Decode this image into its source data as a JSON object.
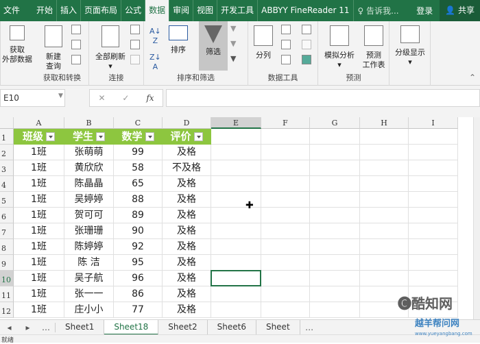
{
  "ribbon_tabs": [
    "文件",
    "开始",
    "插入",
    "页面布局",
    "公式",
    "数据",
    "审阅",
    "视图",
    "开发工具",
    "ABBYY FineReader 11"
  ],
  "active_tab": "数据",
  "tell_me": "告诉我...",
  "login": "登录",
  "share": "共享",
  "groups": {
    "get": {
      "label": "获取和转换",
      "get_external": "获取\n外部数据",
      "new_query": "新建\n查询"
    },
    "conn": {
      "label": "连接",
      "refresh_all": "全部刷新"
    },
    "sort": {
      "label": "排序和筛选",
      "sort": "排序",
      "filter": "筛选"
    },
    "tools": {
      "label": "数据工具",
      "split": "分列"
    },
    "forecast": {
      "label": "预测",
      "whatif": "模拟分析",
      "sheet": "预测\n工作表"
    },
    "outline": {
      "label": "",
      "outline": "分级显示"
    }
  },
  "name_box": "E10",
  "formula": "",
  "columns": [
    "A",
    "B",
    "C",
    "D",
    "E",
    "F",
    "G",
    "H",
    "I"
  ],
  "headers": [
    "班级",
    "学生",
    "数学",
    "评价"
  ],
  "rows": [
    [
      "1班",
      "张萌萌",
      "99",
      "及格"
    ],
    [
      "1班",
      "黄欣欣",
      "58",
      "不及格"
    ],
    [
      "1班",
      "陈晶晶",
      "65",
      "及格"
    ],
    [
      "1班",
      "吴婷婷",
      "88",
      "及格"
    ],
    [
      "1班",
      "贺可可",
      "89",
      "及格"
    ],
    [
      "1班",
      "张珊珊",
      "90",
      "及格"
    ],
    [
      "1班",
      "陈婷婷",
      "92",
      "及格"
    ],
    [
      "1班",
      "陈 洁",
      "95",
      "及格"
    ],
    [
      "1班",
      "吴子航",
      "96",
      "及格"
    ],
    [
      "1班",
      "张一一",
      "86",
      "及格"
    ],
    [
      "1班",
      "庄小小",
      "77",
      "及格"
    ]
  ],
  "sheets": [
    "Sheet1",
    "Sheet18",
    "Sheet2",
    "Sheet6",
    "Sheet"
  ],
  "active_sheet": "Sheet18",
  "status": "就绪",
  "watermark": {
    "line1": "酷知网",
    "line2": "越羊帮问网",
    "url": "www.yueyangbang.com"
  },
  "colors": {
    "green": "#217346",
    "header_fill": "#8dc63f"
  }
}
